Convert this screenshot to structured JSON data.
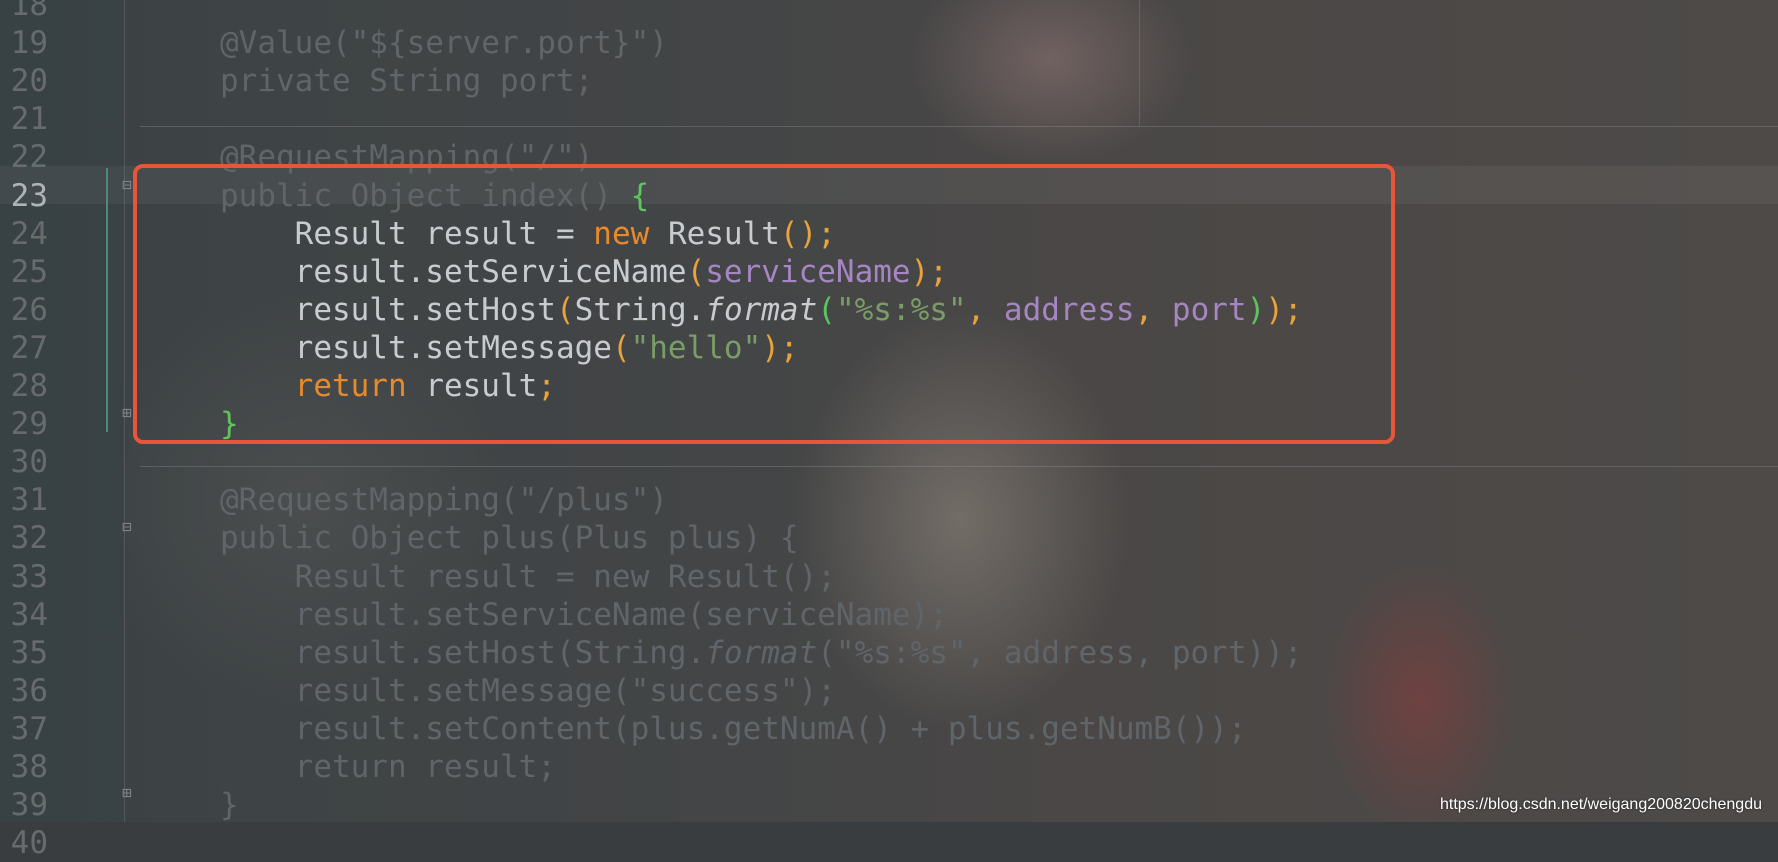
{
  "editor": {
    "active_line": "23",
    "lines": [
      {
        "num": "18",
        "tokens": []
      },
      {
        "num": "19",
        "tokens": [
          {
            "t": "@Value(\"${server.port}\")",
            "c": "dim"
          }
        ]
      },
      {
        "num": "20",
        "tokens": [
          {
            "t": "private String port;",
            "c": "dim"
          }
        ]
      },
      {
        "num": "21",
        "tokens": []
      },
      {
        "num": "22",
        "tokens": [
          {
            "t": "@RequestMapping(\"/\")",
            "c": "dim"
          }
        ]
      },
      {
        "num": "23",
        "tokens": [
          {
            "t": "public Object index() ",
            "c": "dim"
          },
          {
            "t": "{",
            "c": "t-brace"
          }
        ]
      },
      {
        "num": "24",
        "tokens": [
          {
            "t": "    Result result = ",
            "c": "t-plain"
          },
          {
            "t": "new ",
            "c": "t-kw"
          },
          {
            "t": "Result",
            "c": "t-plain"
          },
          {
            "t": "();",
            "c": "t-punct"
          }
        ]
      },
      {
        "num": "25",
        "tokens": [
          {
            "t": "    result.setServiceName",
            "c": "t-plain"
          },
          {
            "t": "(",
            "c": "t-punct"
          },
          {
            "t": "serviceName",
            "c": "t-field"
          },
          {
            "t": ");",
            "c": "t-punct"
          }
        ]
      },
      {
        "num": "26",
        "tokens": [
          {
            "t": "    result.setHost",
            "c": "t-plain"
          },
          {
            "t": "(",
            "c": "t-punct"
          },
          {
            "t": "String.",
            "c": "t-plain"
          },
          {
            "t": "format",
            "c": "t-italic"
          },
          {
            "t": "(",
            "c": "t-brace"
          },
          {
            "t": "\"%s:%s\"",
            "c": "t-str"
          },
          {
            "t": ", ",
            "c": "t-punct"
          },
          {
            "t": "address",
            "c": "t-field"
          },
          {
            "t": ", ",
            "c": "t-punct"
          },
          {
            "t": "port",
            "c": "t-field"
          },
          {
            "t": ")",
            "c": "t-brace"
          },
          {
            "t": ");",
            "c": "t-punct"
          }
        ]
      },
      {
        "num": "27",
        "tokens": [
          {
            "t": "    result.setMessage",
            "c": "t-plain"
          },
          {
            "t": "(",
            "c": "t-punct"
          },
          {
            "t": "\"hello\"",
            "c": "t-str"
          },
          {
            "t": ");",
            "c": "t-punct"
          }
        ]
      },
      {
        "num": "28",
        "tokens": [
          {
            "t": "    ",
            "c": "t-plain"
          },
          {
            "t": "return ",
            "c": "t-kw"
          },
          {
            "t": "result",
            "c": "t-plain"
          },
          {
            "t": ";",
            "c": "t-punct"
          }
        ]
      },
      {
        "num": "29",
        "tokens": [
          {
            "t": "}",
            "c": "t-brace"
          }
        ]
      },
      {
        "num": "30",
        "tokens": []
      },
      {
        "num": "31",
        "tokens": [
          {
            "t": "@RequestMapping(\"/plus\")",
            "c": "dim"
          }
        ]
      },
      {
        "num": "32",
        "tokens": [
          {
            "t": "public Object plus(Plus plus) {",
            "c": "dim"
          }
        ]
      },
      {
        "num": "33",
        "tokens": [
          {
            "t": "    Result result = new Result();",
            "c": "dim"
          }
        ]
      },
      {
        "num": "34",
        "tokens": [
          {
            "t": "    result.setServiceName(serviceName);",
            "c": "dim"
          }
        ]
      },
      {
        "num": "35",
        "tokens": [
          {
            "t": "    result.setHost(String.",
            "c": "dim"
          },
          {
            "t": "format",
            "c": "d-italic"
          },
          {
            "t": "(\"%s:%s\", address, port));",
            "c": "dim"
          }
        ]
      },
      {
        "num": "36",
        "tokens": [
          {
            "t": "    result.setMessage(\"success\");",
            "c": "dim"
          }
        ]
      },
      {
        "num": "37",
        "tokens": [
          {
            "t": "    result.setContent(plus.getNumA() + plus.getNumB());",
            "c": "dim"
          }
        ]
      },
      {
        "num": "38",
        "tokens": [
          {
            "t": "    return result;",
            "c": "dim"
          }
        ]
      },
      {
        "num": "39",
        "tokens": [
          {
            "t": "}",
            "c": "dim"
          }
        ]
      },
      {
        "num": "40",
        "tokens": []
      }
    ]
  },
  "colors": {
    "highlight_border": "#e8563a",
    "keyword": "#e68a2c",
    "field": "#a585c2",
    "string": "#7a9d68",
    "brace_match": "#5ec45e"
  },
  "watermark": "https://blog.csdn.net/weigang200820chengdu"
}
